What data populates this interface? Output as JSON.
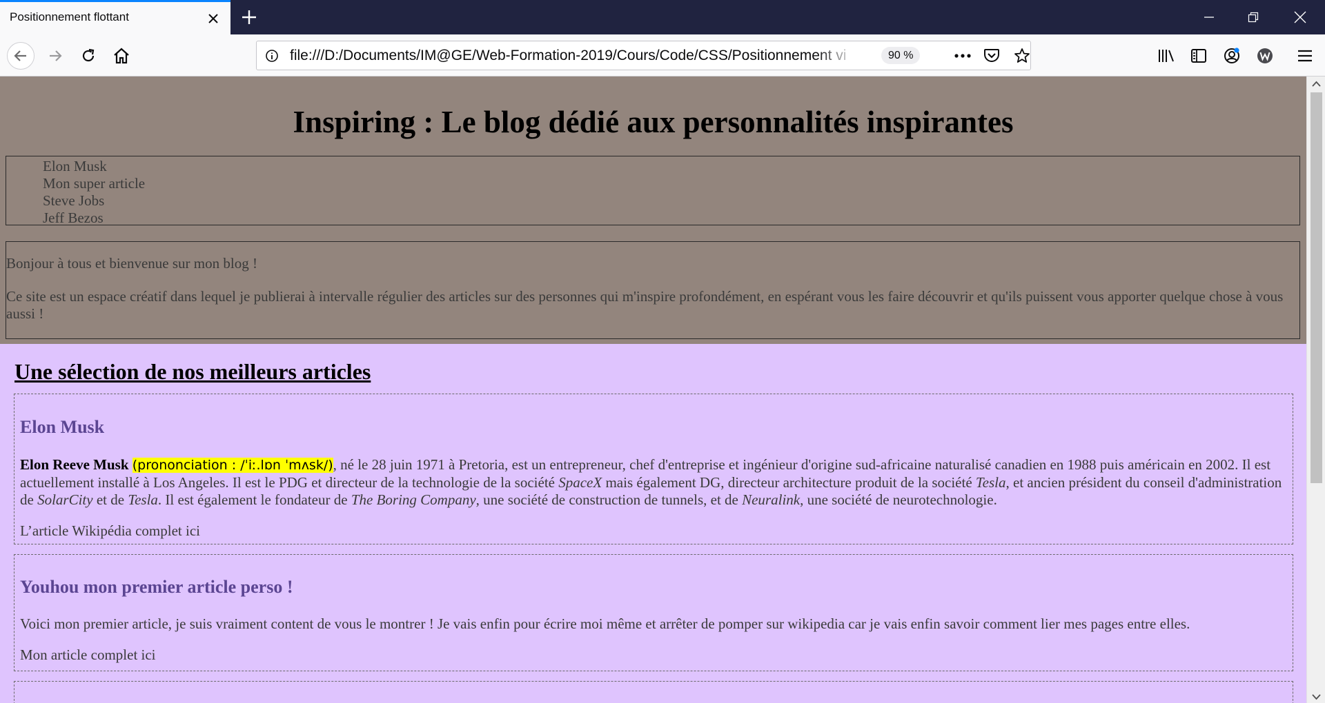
{
  "browser": {
    "tab_title": "Positionnement flottant",
    "url": "file:///D:/Documents/IM@GE/Web-Formation-2019/Cours/Code/CSS/Positionnement vi",
    "zoom": "90 %",
    "accent_color": "#0a84ff",
    "tabbar_color": "#202340"
  },
  "page": {
    "blog_title": "Inspiring : Le blog dédié aux personnalités inspirantes",
    "nav_items": [
      "Elon Musk",
      "Mon super article",
      "Steve Jobs",
      "Jeff Bezos"
    ],
    "intro_p1": "Bonjour à tous et bienvenue sur mon blog !",
    "intro_p2": "Ce site est un espace créatif dans lequel je publierai à intervalle régulier des articles sur des personnes qui m'inspire profondément, en espérant vous les faire découvrir et qu'ils puissent vous apporter quelque chose à vous aussi !",
    "section_title": "Une sélection de nos meilleurs articles",
    "articles": [
      {
        "title": "Elon Musk",
        "name_bold": "Elon Reeve Musk",
        "pronunciation": "(prononciation : /ˈiː.lɒn ˈmʌsk/)",
        "body_parts": [
          ", né le 28 juin 1971 à Pretoria, est un entrepreneur, chef d'entreprise et ingénieur d'origine sud-africaine naturalisé canadien en 1988 puis américain en 2002. Il est actuellement installé à Los Angeles. Il est le PDG et directeur de la technologie de la société ",
          "SpaceX",
          " mais également DG, directeur architecture produit de la société ",
          "Tesla",
          ", et ancien président du conseil d'administration de ",
          "SolarCity",
          " et de ",
          "Tesla",
          ". Il est également le fondateur de ",
          "The Boring Company",
          ", une société de construction de tunnels, et de ",
          "Neuralink",
          ", une société de neurotechnologie."
        ],
        "link": "L’article Wikipédia complet ici"
      },
      {
        "title": "Youhou mon premier article perso !",
        "body": "Voici mon premier article, je suis vraiment content de vous le montrer ! Je vais enfin pour écrire moi même et arrêter de pomper sur wikipedia car je vais enfin savoir comment lier mes pages entre elles.",
        "link": "Mon article complet ici"
      }
    ],
    "colors": {
      "header_bg": "#93857d",
      "content_bg": "#dfc4fe",
      "article_title": "#5b4592",
      "highlight": "#ffff00"
    }
  }
}
